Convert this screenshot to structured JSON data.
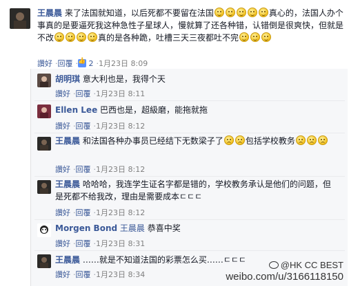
{
  "post": {
    "name": "王晨晨",
    "text_parts": [
      "来了法国就知道，以后死都不要留在法国",
      "真心的，法国人办个事真的是要逼死我这种急性子星球人，慢就算了还各种错，认错倒是很爽快，但就是不改",
      "真的是各种跪，吐槽三天三夜都吐不完"
    ],
    "like_label": "讚好",
    "reply_label": "回覆",
    "likes": "2",
    "date": "1月23日",
    "time": "8:09"
  },
  "replies": [
    {
      "name": "胡明琪",
      "text": "意大利也是，我得个天",
      "like": "讚好",
      "reply": "回覆",
      "date": "1月23日",
      "time": "8:11"
    },
    {
      "name": "Ellen Lee",
      "text": "巴西也是，超級磨，能拖就拖",
      "like": "讚好",
      "reply": "回覆",
      "date": "1月23日",
      "time": "8:12"
    },
    {
      "name": "王晨晨",
      "text": "和法国各种办事员已经结下无数梁子了",
      "text2": "包括学校教务",
      "like": "讚好",
      "reply": "回覆",
      "date": "1月23日",
      "time": "8:12"
    },
    {
      "name": "王晨晨",
      "text": "哈哈哈，我连学生证名字都是错的，学校教务承认是他们的问题，但是死都不给我改，理由是需要成本ㄷㄷㄷ",
      "like": "讚好",
      "reply": "回覆",
      "date": "1月23日",
      "time": "8:12"
    },
    {
      "name": "Morgen Bond",
      "tag": "王晨晨",
      "text": "恭喜中奖",
      "like": "讚好",
      "reply": "回覆",
      "date": "1月23日",
      "time": "8:31"
    },
    {
      "name": "王晨晨",
      "text": "……就是不知道法国的彩票怎么买……ㄷㄷㄷ",
      "like": "讚好",
      "reply": "回覆",
      "date": "1月23日",
      "time": "8:34"
    }
  ],
  "watermark": {
    "handle": "@HK CC BEST",
    "url": "weibo.com/u/3166118150"
  },
  "colors": {
    "link": "#3b5998",
    "meta": "#7f7f7f",
    "reply_bg": "#f6f7f9",
    "like_badge": "#5890ff"
  }
}
